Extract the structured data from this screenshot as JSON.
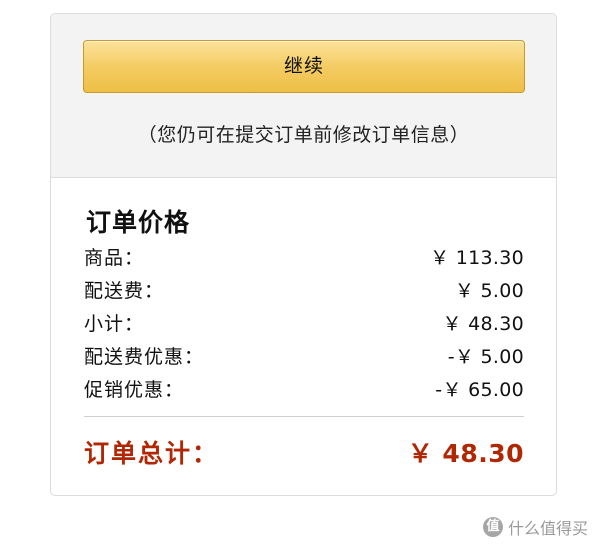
{
  "checkout": {
    "continue_label": "继续",
    "note": "（您仍可在提交订单前修改订单信息）"
  },
  "summary": {
    "title": "订单价格",
    "rows": [
      {
        "label": "商品：",
        "value": "￥ 113.30"
      },
      {
        "label": "配送费：",
        "value": "￥ 5.00"
      },
      {
        "label": "小计：",
        "value": "￥ 48.30"
      },
      {
        "label": "配送费优惠：",
        "value": "-￥ 5.00"
      },
      {
        "label": "促销优惠：",
        "value": "-￥ 65.00"
      }
    ],
    "total": {
      "label": "订单总计：",
      "value": "￥ 48.30"
    }
  },
  "colors": {
    "total": "#b12704",
    "button_top": "#fbe29b",
    "button_bottom": "#eebf45"
  },
  "watermark": {
    "logo": "值",
    "text": "什么值得买"
  }
}
